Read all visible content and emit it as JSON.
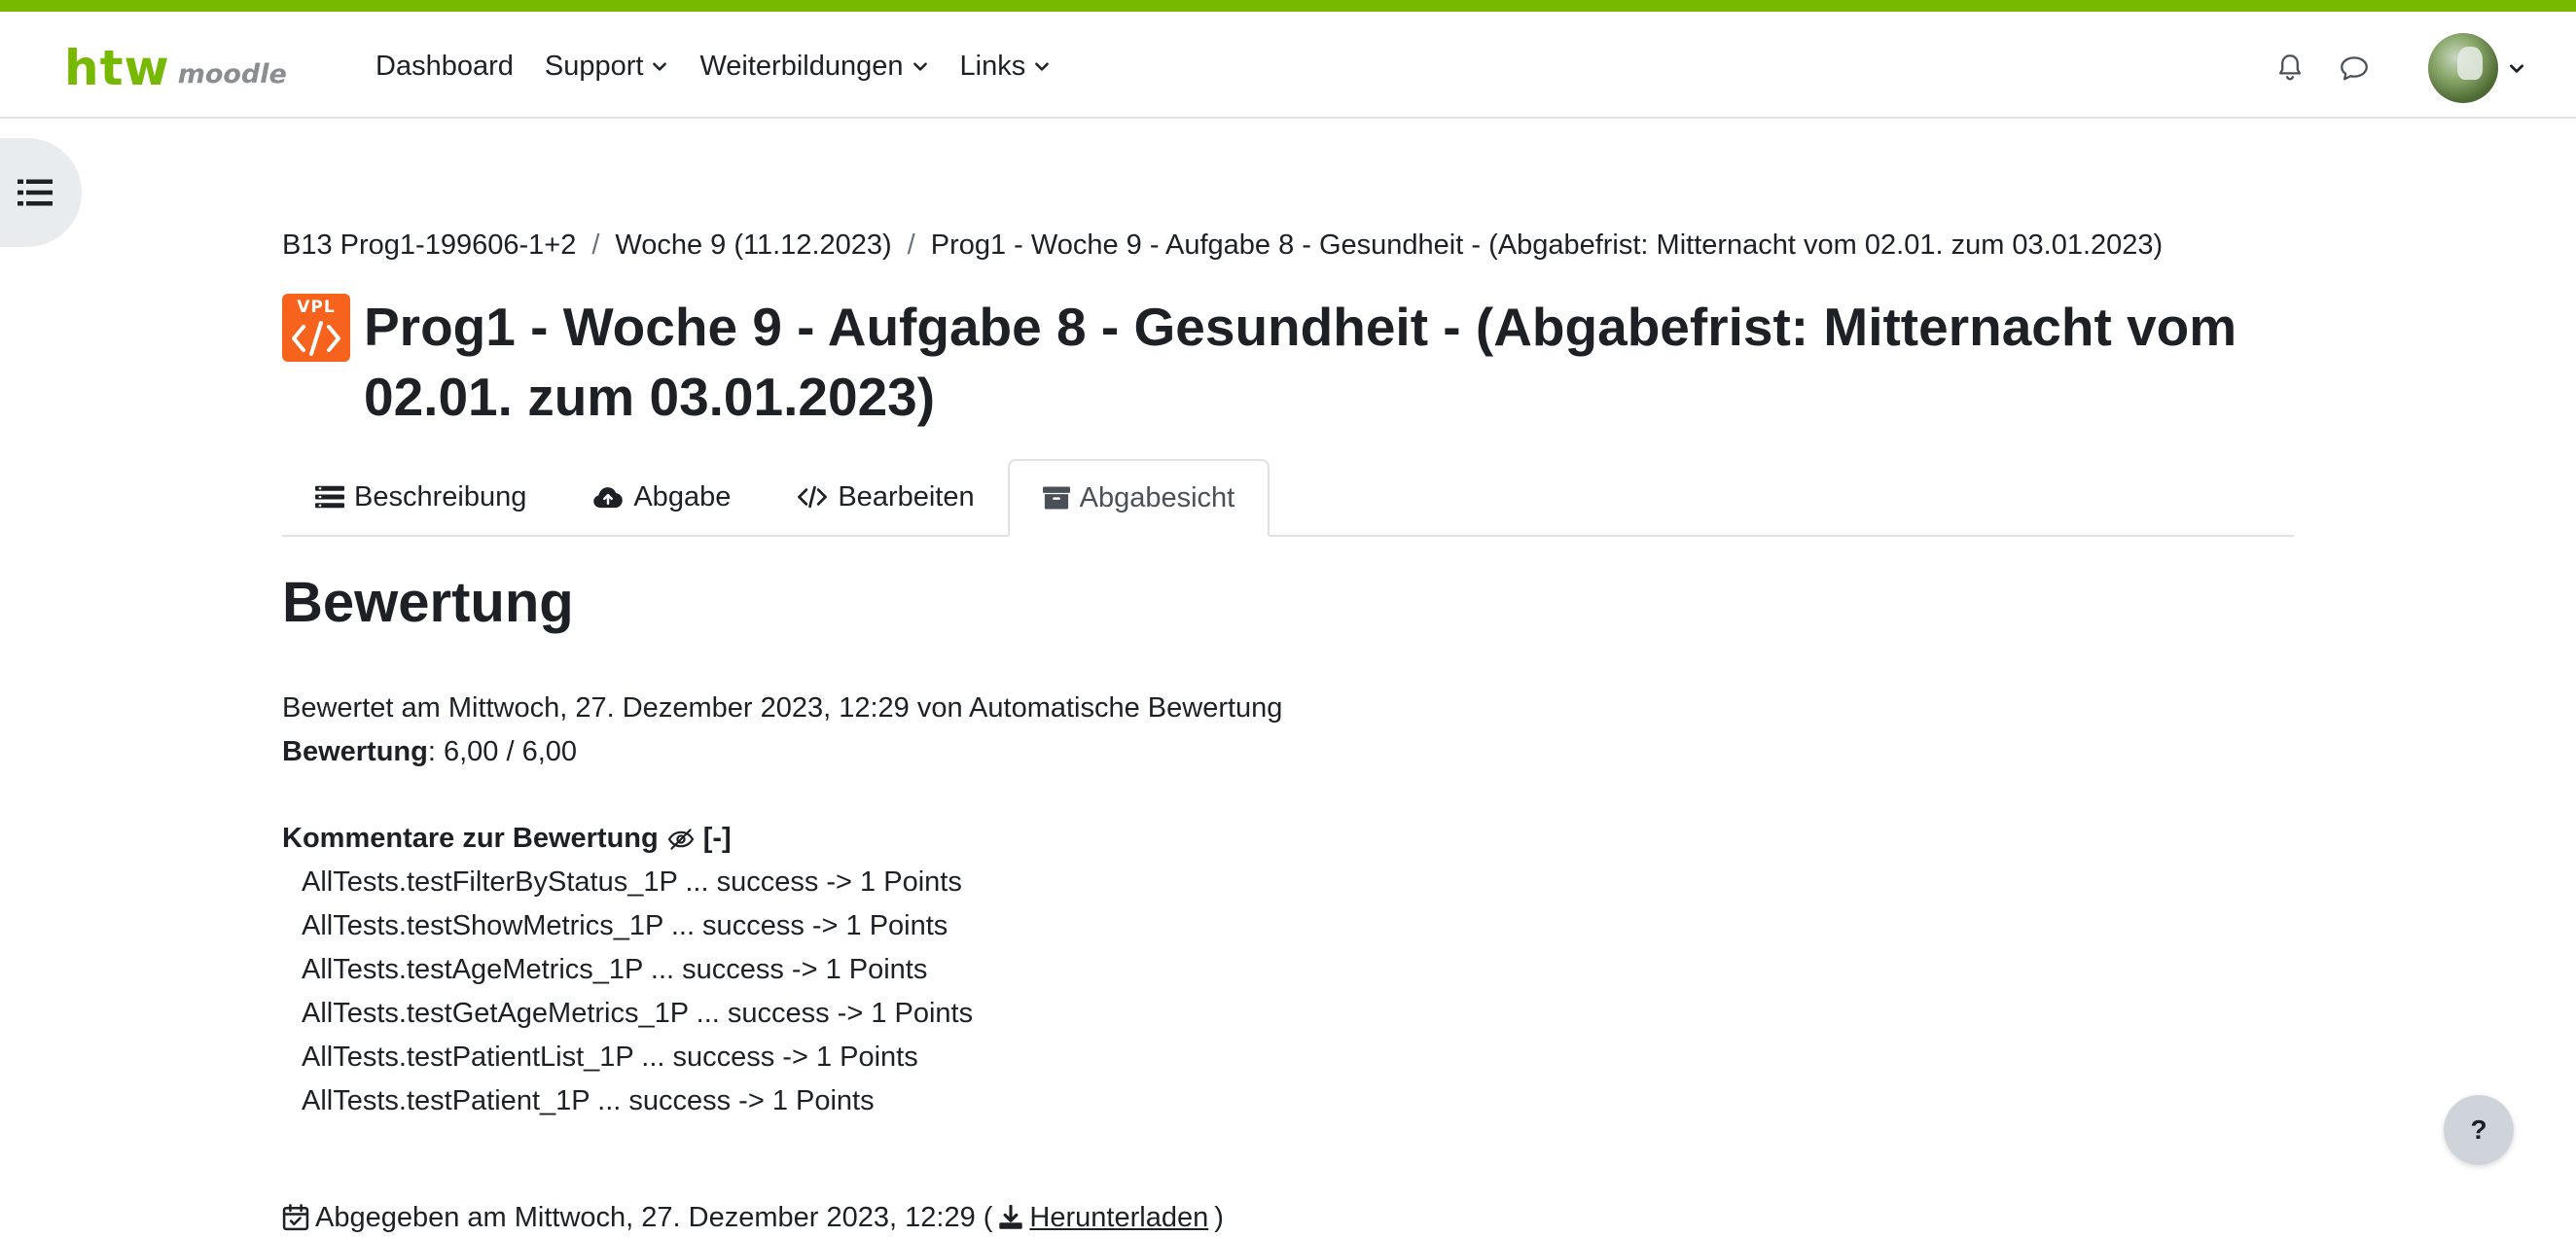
{
  "brand": {
    "logo_main": "htw",
    "logo_sub": "moodle",
    "accent": "#76b900"
  },
  "nav": {
    "items": [
      {
        "label": "Dashboard",
        "dropdown": false
      },
      {
        "label": "Support",
        "dropdown": true
      },
      {
        "label": "Weiterbildungen",
        "dropdown": true
      },
      {
        "label": "Links",
        "dropdown": true
      }
    ],
    "icons": [
      "bell-icon",
      "chat-bubble-icon",
      "avatar",
      "chevron-down-icon"
    ]
  },
  "breadcrumb": [
    "B13 Prog1-199606-1+2",
    "Woche 9 (11.12.2023)",
    "Prog1 - Woche 9 - Aufgabe 8 - Gesundheit - (Abgabefrist: Mitternacht vom 02.01. zum 03.01.2023)"
  ],
  "activity": {
    "icon_text": "VPL",
    "icon_color": "#f7631c",
    "title": "Prog1 - Woche 9 - Aufgabe 8 - Gesundheit - (Abgabefrist: Mitternacht vom 02.01. zum 03.01.2023)"
  },
  "tabs": [
    {
      "label": "Beschreibung",
      "icon": "list-icon",
      "active": false
    },
    {
      "label": "Abgabe",
      "icon": "cloud-upload-icon",
      "active": false
    },
    {
      "label": "Bearbeiten",
      "icon": "code-icon",
      "active": false
    },
    {
      "label": "Abgabesicht",
      "icon": "archive-icon",
      "active": true
    }
  ],
  "grading": {
    "heading": "Bewertung",
    "graded_text": "Bewertet am Mittwoch, 27. Dezember 2023, 12:29 von Automatische Bewertung",
    "grade_label": "Bewertung",
    "grade_value": ": 6,00 / 6,00",
    "comments_label": "Kommentare zur Bewertung",
    "comments_toggle": "[-]",
    "tests": [
      "AllTests.testFilterByStatus_1P ... success -> 1 Points",
      "AllTests.testShowMetrics_1P ... success -> 1 Points",
      "AllTests.testAgeMetrics_1P ... success -> 1 Points",
      "AllTests.testGetAgeMetrics_1P ... success -> 1 Points",
      "AllTests.testPatientList_1P ... success -> 1 Points",
      "AllTests.testPatient_1P ... success -> 1 Points"
    ]
  },
  "submission": {
    "text": "Abgegeben am Mittwoch, 27. Dezember 2023, 12:29 (",
    "download_label": "Herunterladen",
    "close": ")"
  },
  "help": {
    "label": "?"
  }
}
